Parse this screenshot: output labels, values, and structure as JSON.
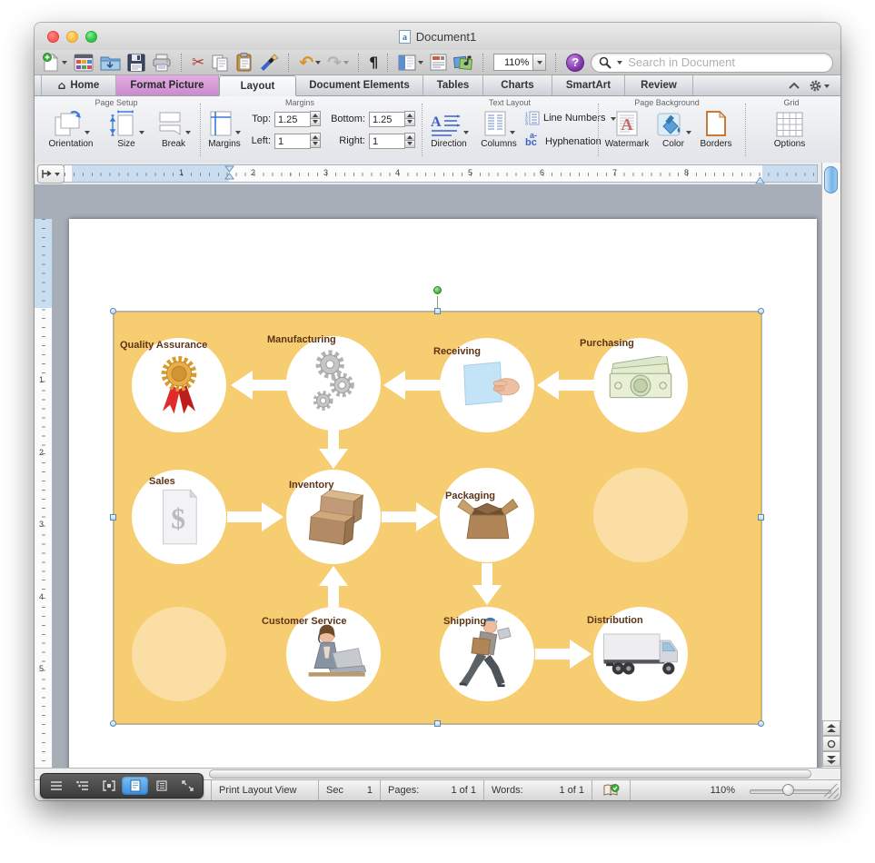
{
  "window": {
    "title": "Document1"
  },
  "toolbar": {
    "zoom_value": "110%",
    "pilcrow": "¶",
    "search_placeholder": "Search in Document"
  },
  "tabs": {
    "items": [
      "Home",
      "Format Picture",
      "Layout",
      "Document Elements",
      "Tables",
      "Charts",
      "SmartArt",
      "Review"
    ],
    "active": "Layout"
  },
  "ribbon": {
    "page_setup": {
      "label": "Page Setup",
      "orientation": "Orientation",
      "size": "Size",
      "break_btn": "Break"
    },
    "margins": {
      "label": "Margins",
      "button": "Margins",
      "top_label": "Top:",
      "top_value": "1.25",
      "bottom_label": "Bottom:",
      "bottom_value": "1.25",
      "left_label": "Left:",
      "left_value": "1",
      "right_label": "Right:",
      "right_value": "1"
    },
    "text_layout": {
      "label": "Text Layout",
      "direction": "Direction",
      "columns": "Columns",
      "line_numbers": "Line Numbers",
      "hyphenation": "Hyphenation",
      "hyphenation_icon": "bc",
      "hyphenation_icon_sup": "a-"
    },
    "page_background": {
      "label": "Page Background",
      "watermark": "Watermark",
      "color": "Color",
      "borders": "Borders"
    },
    "grid": {
      "label": "Grid",
      "options": "Options"
    }
  },
  "ruler": {
    "h_numbers": [
      "1",
      "2",
      "3",
      "4",
      "5",
      "6",
      "7",
      "8"
    ],
    "v_numbers": [
      "1",
      "2",
      "3",
      "4",
      "5"
    ]
  },
  "diagram": {
    "nodes": [
      {
        "label": "Quality Assurance",
        "icon": "award-icon"
      },
      {
        "label": "Manufacturing",
        "icon": "gears-icon"
      },
      {
        "label": "Receiving",
        "icon": "hand-package-icon"
      },
      {
        "label": "Purchasing",
        "icon": "money-icon"
      },
      {
        "label": "Sales",
        "icon": "invoice-icon"
      },
      {
        "label": "Inventory",
        "icon": "boxes-icon"
      },
      {
        "label": "Packaging",
        "icon": "open-box-icon"
      },
      {
        "label": "Customer Service",
        "icon": "support-agent-icon"
      },
      {
        "label": "Shipping",
        "icon": "courier-icon"
      },
      {
        "label": "Distribution",
        "icon": "truck-icon"
      }
    ],
    "colors": {
      "background": "#F7CD72",
      "node_fill": "#FFFFFF",
      "label": "#5C3317",
      "arrow": "#FFFFFF"
    }
  },
  "statusbar": {
    "view": "Print Layout View",
    "sec_label": "Sec",
    "sec_value": "1",
    "pages_label": "Pages:",
    "pages_value": "1 of 1",
    "words_label": "Words:",
    "words_value": "1 of 1",
    "zoom_value": "110%"
  }
}
